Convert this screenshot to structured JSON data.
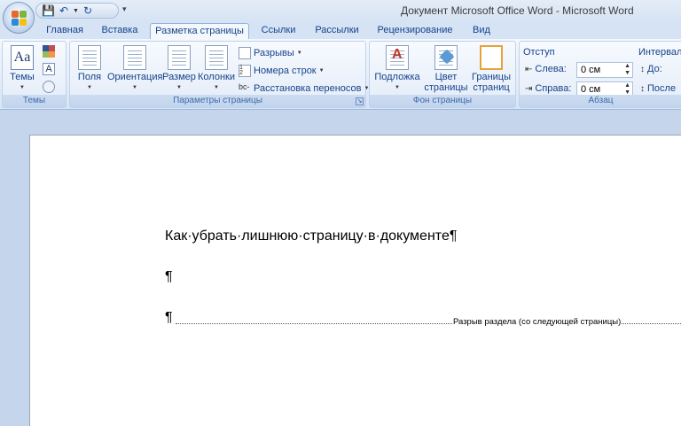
{
  "title": "Документ Microsoft Office Word - Microsoft Word",
  "tabs": [
    "Главная",
    "Вставка",
    "Разметка страницы",
    "Ссылки",
    "Рассылки",
    "Рецензирование",
    "Вид"
  ],
  "groups": {
    "themes": {
      "label": "Темы",
      "themes_btn": "Темы"
    },
    "page_setup": {
      "label": "Параметры страницы",
      "fields": "Поля",
      "orientation": "Ориентация",
      "size": "Размер",
      "columns": "Колонки",
      "breaks": "Разрывы",
      "line_numbers": "Номера строк",
      "hyphenation": "Расстановка переносов"
    },
    "page_background": {
      "label": "Фон страницы",
      "watermark": "Подложка",
      "page_color_1": "Цвет",
      "page_color_2": "страницы",
      "page_borders_1": "Границы",
      "page_borders_2": "страниц"
    },
    "paragraph": {
      "label": "Абзац",
      "indent_title": "Отступ",
      "left_label": "Слева:",
      "left_value": "0 см",
      "right_label": "Справа:",
      "right_value": "0 см",
      "spacing_title": "Интервал",
      "before_label": "До:",
      "after_label": "После"
    }
  },
  "document": {
    "heading": "Как·убрать·лишнюю·страницу·в·документе¶",
    "empty_para": "¶",
    "break_para": "¶",
    "section_break": "Разрыв раздела (со следующей страницы)"
  },
  "colors": {
    "ribbon_text": "#15428b",
    "workspace": "#c5d6ec",
    "tab_bar": "#d5e3f4"
  }
}
